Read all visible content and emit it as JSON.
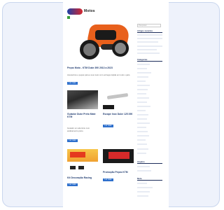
{
  "site": {
    "logo_text": "Motos"
  },
  "hero": {
    "title": "Peças Moto - KTM Duke 390 2013 a 2023",
    "excerpt": "Acessórios e peças para a sua moto com entrega rápida em todo o país."
  },
  "posts": [
    {
      "title": "Guiador Duke Preto Mate KTM",
      "excerpt": "Guiador em alumínio com acabamento preto."
    },
    {
      "title": "Escape Inox Duke 125 390",
      "excerpt": ""
    },
    {
      "title": "Kit Decoração Racing",
      "excerpt": ""
    },
    {
      "title": "Promoção Peças KTM",
      "excerpt": ""
    }
  ],
  "more_label": "Ler mais",
  "sidebar": {
    "search_placeholder": "Pesquisar...",
    "widget1_title": "Artigos recentes",
    "widget2_title": "Categorias",
    "widget3_title": "Arquivo",
    "widget4_title": "Meta"
  },
  "colors": {
    "accent": "#2d6fcc",
    "bike_orange": "#e8601c",
    "widget_rule": "#1c2d5a"
  }
}
